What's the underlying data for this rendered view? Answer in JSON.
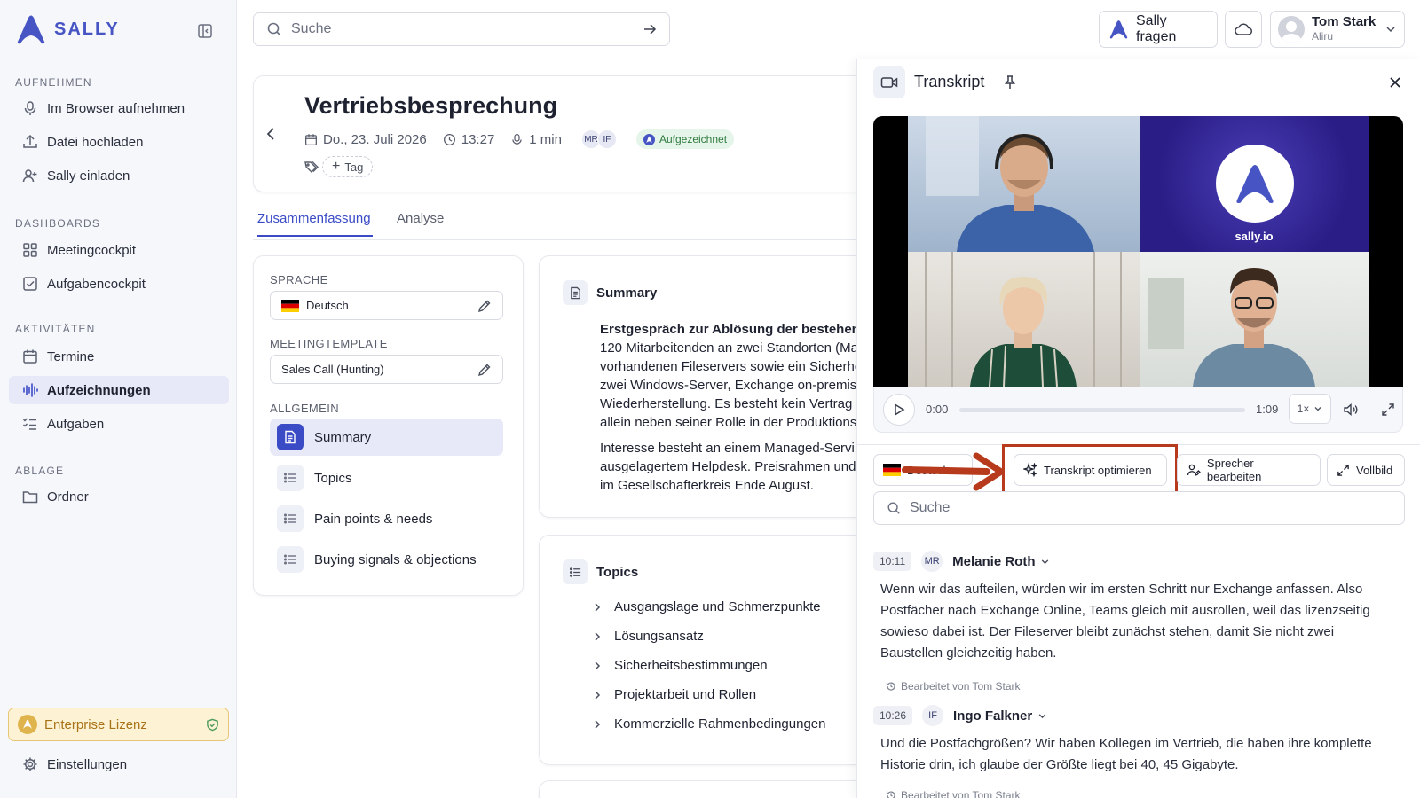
{
  "app": {
    "logo_text": "SALLY",
    "brand_color": "#4654c4"
  },
  "sidebar": {
    "sections": [
      {
        "title": "AUFNEHMEN",
        "items": [
          {
            "label": "Im Browser aufnehmen",
            "icon": "mic-icon"
          },
          {
            "label": "Datei hochladen",
            "icon": "upload-icon"
          },
          {
            "label": "Sally einladen",
            "icon": "user-plus-icon"
          }
        ]
      },
      {
        "title": "DASHBOARDS",
        "items": [
          {
            "label": "Meetingcockpit",
            "icon": "grid-icon"
          },
          {
            "label": "Aufgabencockpit",
            "icon": "check-square-icon"
          }
        ]
      },
      {
        "title": "AKTIVITÄTEN",
        "items": [
          {
            "label": "Termine",
            "icon": "calendar-icon"
          },
          {
            "label": "Aufzeichnungen",
            "icon": "waveform-icon",
            "active": true
          },
          {
            "label": "Aufgaben",
            "icon": "task-list-icon"
          }
        ]
      },
      {
        "title": "ABLAGE",
        "items": [
          {
            "label": "Ordner",
            "icon": "folder-icon"
          }
        ]
      }
    ],
    "license": "Enterprise Lizenz",
    "settings": "Einstellungen"
  },
  "topbar": {
    "search_placeholder": "Suche",
    "ask_sally": "Sally fragen",
    "user_name": "Tom Stark",
    "user_org": "Aliru"
  },
  "meeting": {
    "title": "Vertriebsbesprechung",
    "date": "Do., 23. Juli 2026",
    "time": "13:27",
    "duration": "1 min",
    "participants": [
      "MR",
      "IF"
    ],
    "status": "Aufgezeichnet",
    "tag_button": "Tag"
  },
  "tabs": [
    "Zusammenfassung",
    "Analyse"
  ],
  "settings_panel": {
    "language_label": "SPRACHE",
    "language_value": "Deutsch",
    "template_label": "MEETINGTEMPLATE",
    "template_value": "Sales Call (Hunting)",
    "general_label": "ALLGEMEIN",
    "items": [
      "Summary",
      "Topics",
      "Pain points & needs",
      "Buying signals & objections"
    ]
  },
  "summary": {
    "heading": "Summary",
    "bold_line": "Erstgespräch zur Ablösung der bestehend",
    "para1": [
      "120 Mitarbeitenden an zwei Standorten (Ma",
      "vorhandenen Fileservers sowie ein Sicherhe",
      "zwei Windows-Server, Exchange on-premis",
      "Wiederherstellung. Es besteht kein Vertrag",
      "allein neben seiner Rolle in der Produktions"
    ],
    "para2": [
      "Interesse besteht an einem Managed-Servi",
      "ausgelagertem Helpdesk. Preisrahmen und",
      "im Gesellschafterkreis Ende August."
    ]
  },
  "topics": {
    "heading": "Topics",
    "items": [
      "Ausgangslage und Schmerzpunkte",
      "Lösungsansatz",
      "Sicherheitsbestimmungen",
      "Projektarbeit und Rollen",
      "Kommerzielle Rahmenbedingungen"
    ]
  },
  "transcript": {
    "title": "Transkript",
    "video_brand": "sally.io",
    "player": {
      "current": "0:00",
      "total": "1:09",
      "speed": "1×",
      "progress": 0
    },
    "language": "Deutsch",
    "optimize_button": "Transkript optimieren",
    "speaker_button": "Sprecher bearbeiten",
    "fullscreen_button": "Vollbild",
    "search_placeholder": "Suche",
    "highlight_color": "#b83a1c",
    "entries": [
      {
        "time": "10:11",
        "initials": "MR",
        "speaker": "Melanie Roth",
        "text": [
          "Wenn wir das aufteilen, würden wir im ersten Schritt nur Exchange anfassen. Also",
          "Postfächer nach Exchange Online, Teams gleich mit ausrollen, weil das lizenzseitig",
          "sowieso dabei ist. Der Fileserver bleibt zunächst stehen, damit Sie nicht zwei",
          "Baustellen gleichzeitig haben."
        ],
        "edited": "Bearbeitet von Tom Stark"
      },
      {
        "time": "10:26",
        "initials": "IF",
        "speaker": "Ingo Falkner",
        "text": [
          "Und die Postfachgrößen? Wir haben Kollegen im Vertrieb, die haben ihre komplette",
          "Historie drin, ich glaube der Größte liegt bei 40, 45 Gigabyte."
        ],
        "edited": "Bearbeitet von Tom Stark"
      }
    ]
  }
}
